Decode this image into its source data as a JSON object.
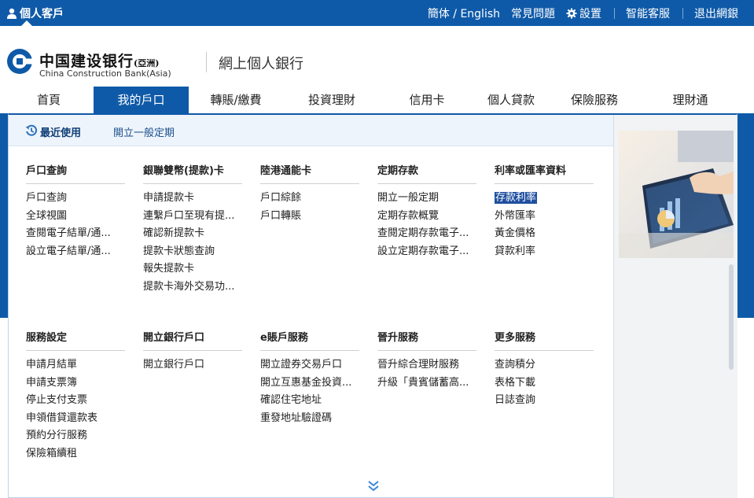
{
  "topbar": {
    "personal": "個人客戶",
    "links": [
      "簡体 / English",
      "常見問題",
      "設置",
      "智能客服",
      "退出網銀"
    ]
  },
  "brand": {
    "name_cn": "中国建设银行",
    "name_suffix": "(亞洲)",
    "name_en": "China Construction Bank(Asia)",
    "site_title": "網上個人銀行"
  },
  "nav": {
    "tabs": [
      "首頁",
      "我的戶口",
      "轉賬/繳費",
      "投資理財",
      "信用卡",
      "個人貸款",
      "保險服務",
      "理財通"
    ],
    "active": "我的戶口"
  },
  "recent": {
    "label": "最近使用",
    "link": "開立一般定期"
  },
  "columns": [
    {
      "heading": "戶口查詢",
      "items": [
        "戶口查詢",
        "全球視圖",
        "查閱電子結單/通...",
        "設立電子結單/通..."
      ]
    },
    {
      "heading": "銀聯雙幣(提款)卡",
      "items": [
        "申請提款卡",
        "連繫戶口至現有提...",
        "確認新提款卡",
        "提款卡狀態查詢",
        "報失提款卡",
        "提款卡海外交易功..."
      ]
    },
    {
      "heading": "陸港通能卡",
      "items": [
        "戶口綜餘",
        "戶口轉賬"
      ]
    },
    {
      "heading": "定期存款",
      "items": [
        "開立一般定期",
        "定期存款概覽",
        "查閱定期存款電子...",
        "設立定期存款電子..."
      ]
    },
    {
      "heading": "利率或匯率資料",
      "items": [
        "存款利率",
        "外幣匯率",
        "黃金價格",
        "貸款利率"
      ],
      "highlighted": "存款利率"
    },
    {
      "heading": "服務設定",
      "items": [
        "申請月結單",
        "申請支票簿",
        "停止支付支票",
        "申領借貸還款表",
        "預約分行服務",
        "保險箱續租"
      ]
    },
    {
      "heading": "開立銀行戶口",
      "items": [
        "開立銀行戶口"
      ]
    },
    {
      "heading": "e賬戶服務",
      "items": [
        "開立證券交易戶口",
        "開立互惠基金投資...",
        "確認住宅地址",
        "重發地址驗證碼"
      ]
    },
    {
      "heading": "晉升服務",
      "items": [
        "晉升綜合理財服務",
        "升級「貴賓儲蓄高..."
      ]
    },
    {
      "heading": "更多服務",
      "items": [
        "查詢積分",
        "表格下載",
        "日誌查詢"
      ]
    }
  ],
  "colors": {
    "brand_blue": "#0f5aa8",
    "highlight": "#1f4f9f",
    "recent_bg": "#eef4fb"
  },
  "icons": [
    "user-icon",
    "gear-icon",
    "ccb-logo-icon",
    "clock-history-icon",
    "double-chevron-down-icon"
  ]
}
